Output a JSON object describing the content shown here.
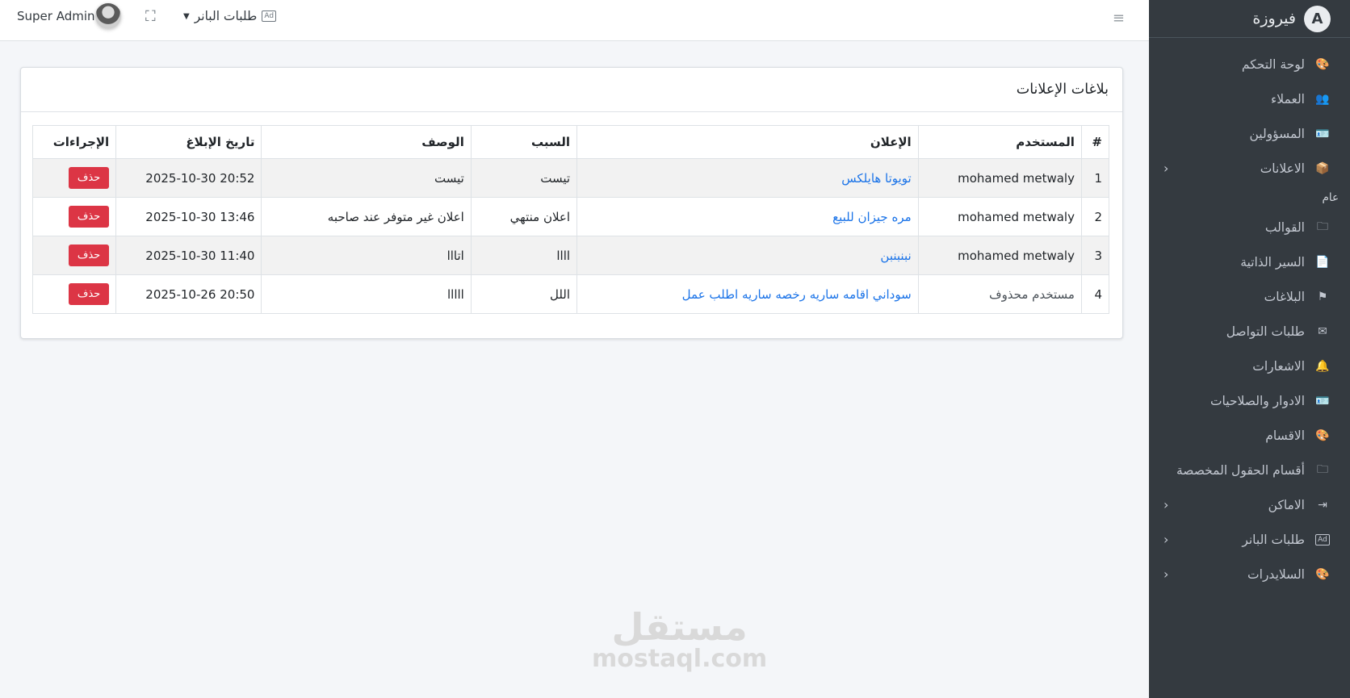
{
  "sidebar": {
    "brand": "فيروزة",
    "logo_letter": "A",
    "section_header": "عام",
    "items": [
      {
        "label": "لوحة التحكم",
        "icon": "palette-icon",
        "glyph": "🎨"
      },
      {
        "label": "العملاء",
        "icon": "users-icon",
        "glyph": "👥"
      },
      {
        "label": "المسؤولين",
        "icon": "id-card-icon",
        "glyph": "🪪"
      },
      {
        "label": "الاعلانات",
        "icon": "box-icon",
        "glyph": "📦",
        "arrow": "‹"
      },
      {
        "label": "القوالب",
        "icon": "folder-icon",
        "glyph": "🗀"
      },
      {
        "label": "السير الذاتية",
        "icon": "file-user-icon",
        "glyph": "📄"
      },
      {
        "label": "البلاغات",
        "icon": "flag-icon",
        "glyph": "⚑"
      },
      {
        "label": "طلبات التواصل",
        "icon": "envelope-icon",
        "glyph": "✉"
      },
      {
        "label": "الاشعارات",
        "icon": "bell-icon",
        "glyph": "🔔"
      },
      {
        "label": "الادوار والصلاحيات",
        "icon": "id-badge-icon",
        "glyph": "🪪"
      },
      {
        "label": "الاقسام",
        "icon": "palette-icon",
        "glyph": "🎨"
      },
      {
        "label": "أقسام الحقول المخصصة",
        "icon": "folder-plus-icon",
        "glyph": "🗀"
      },
      {
        "label": "الاماكن",
        "icon": "sign-in-icon",
        "glyph": "⇥",
        "arrow": "‹"
      },
      {
        "label": "طلبات البانر",
        "icon": "ad-icon",
        "glyph": "Ad",
        "arrow": "‹"
      },
      {
        "label": "السلايدرات",
        "icon": "palette-icon",
        "glyph": "🎨",
        "arrow": "‹"
      }
    ]
  },
  "topbar": {
    "admin_name": "Super Admin",
    "banner_dropdown_label": "طلبات البانر",
    "ad_badge": "Ad",
    "hamburger_glyph": "≡",
    "expand_glyph": "⛶",
    "caret_glyph": "▼"
  },
  "card": {
    "title": "بلاغات الإعلانات",
    "columns": [
      "#",
      "المستخدم",
      "الإعلان",
      "السبب",
      "الوصف",
      "تاريخ الإبلاغ",
      "الإجراءات"
    ],
    "delete_label": "حذف",
    "rows": [
      {
        "num": "1",
        "user": "mohamed metwaly",
        "ad": "تويوتا هايلكس",
        "reason": "تيست",
        "desc": "تيست",
        "date": "2025-10-30 20:52"
      },
      {
        "num": "2",
        "user": "mohamed metwaly",
        "ad": "مره جيزان للبيع",
        "reason": "اعلان منتهي",
        "desc": "اعلان غير متوفر عند صاحبه",
        "date": "2025-10-30 13:46"
      },
      {
        "num": "3",
        "user": "mohamed metwaly",
        "ad": "نبنبنبن",
        "reason": "اااا",
        "desc": "اتااا",
        "date": "2025-10-30 11:40"
      },
      {
        "num": "4",
        "user": "مستخدم محذوف",
        "ad": "سوداني اقامه ساريه رخصه ساريه اطلب عمل",
        "reason": "اللل",
        "desc": "ااااا",
        "date": "2025-10-26 20:50"
      }
    ]
  },
  "watermark": {
    "arabic": "مستقل",
    "latin": "mostaql.com"
  }
}
